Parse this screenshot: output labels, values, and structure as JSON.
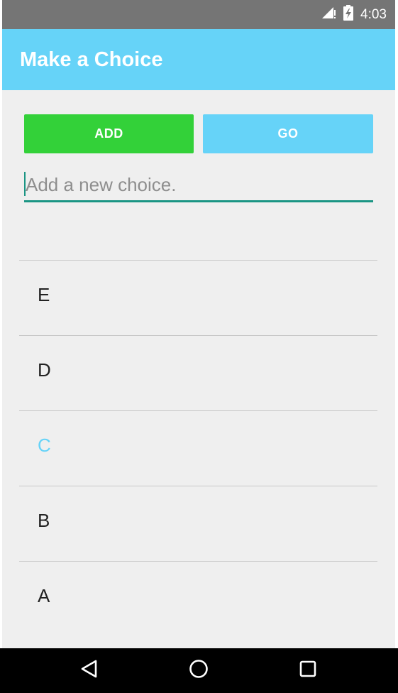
{
  "status_bar": {
    "time": "4:03",
    "signal_icon": "cell-signal-icon",
    "battery_icon": "battery-charging-icon"
  },
  "app_bar": {
    "title": "Make a Choice",
    "color": "#66d3f8"
  },
  "actions": {
    "add_label": "ADD",
    "add_color": "#33d139",
    "go_label": "GO",
    "go_color": "#66d3f8"
  },
  "choice_input": {
    "value": "",
    "placeholder": "Add a new choice."
  },
  "choices": {
    "items": [
      {
        "label": "E",
        "selected": false
      },
      {
        "label": "D",
        "selected": false
      },
      {
        "label": "C",
        "selected": true
      },
      {
        "label": "B",
        "selected": false
      },
      {
        "label": "A",
        "selected": false
      }
    ],
    "selected_color": "#66d3f8"
  },
  "nav_bar": {
    "back_icon": "back-triangle-icon",
    "home_icon": "home-circle-icon",
    "recents_icon": "recents-square-icon"
  }
}
